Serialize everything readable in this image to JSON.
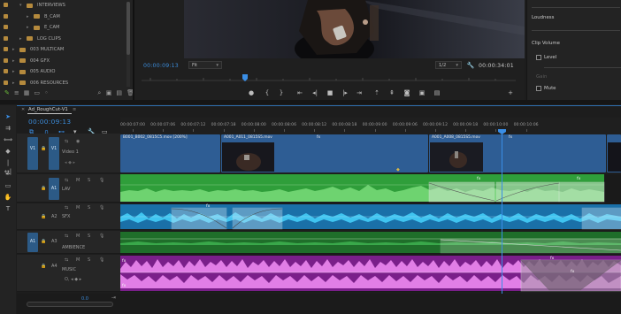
{
  "project": {
    "bins": [
      {
        "label": "INTERVIEWS",
        "expanded": true,
        "indent": 1
      },
      {
        "label": "B_CAM",
        "expanded": false,
        "indent": 2
      },
      {
        "label": "E_CAM",
        "expanded": false,
        "indent": 2
      },
      {
        "label": "LOG CLIPS",
        "expanded": false,
        "indent": 1
      },
      {
        "label": "003 MULTICAM",
        "expanded": false,
        "indent": 0
      },
      {
        "label": "004 GFX",
        "expanded": false,
        "indent": 0
      },
      {
        "label": "005 AUDIO",
        "expanded": false,
        "indent": 0
      },
      {
        "label": "006 RESOURCES",
        "expanded": false,
        "indent": 0
      }
    ]
  },
  "monitor": {
    "timecode": "00:00:09:13",
    "fit": "Fit",
    "resolution": "1/2",
    "duration": "00:00:34:01"
  },
  "effect_controls": {
    "loudness_label": "Loudness",
    "clip_volume_label": "Clip Volume",
    "level_label": "Level",
    "gain_label": "Gain",
    "mute_label": "Mute"
  },
  "timeline": {
    "sequence_name": "Ad_RoughCut-V1",
    "timecode": "00:00:09:13",
    "ruler_labels": [
      "00:00:07:00",
      "00:00:07:06",
      "00:00:07:12",
      "00:00:07:18",
      "00:00:08:00",
      "00:00:08:06",
      "00:00:08:12",
      "00:00:08:18",
      "00:00:09:00",
      "00:00:09:06",
      "00:00:09:12",
      "00:00:09:18",
      "00:00:10:00",
      "00:00:10:06"
    ],
    "tracks": {
      "v1": {
        "src": "V1",
        "tgt": "V1",
        "name": "Video 1"
      },
      "a1": {
        "tgt": "A1",
        "name": "LAV"
      },
      "a2": {
        "tgt": "A2",
        "name": "SFX"
      },
      "a3": {
        "src": "A1",
        "tgt": "A3",
        "name": "AMBIENCE"
      },
      "a4": {
        "tgt": "A4",
        "name": "MUSIC"
      }
    },
    "v1_clips": [
      {
        "label": "B001_B002_0815C5.mov [200%]"
      },
      {
        "label": "A001_A011_0815S5.mov"
      },
      {
        "label": "A001_A008_0815S5.mov"
      }
    ],
    "volume_value": "0.0",
    "colors": {
      "video_clip": "#2e5d94",
      "lav_clip": "#2f9e3a",
      "sfx_clip": "#1d8fd0",
      "music_clip": "#d55cd8",
      "playhead": "#3a8ee6"
    }
  }
}
